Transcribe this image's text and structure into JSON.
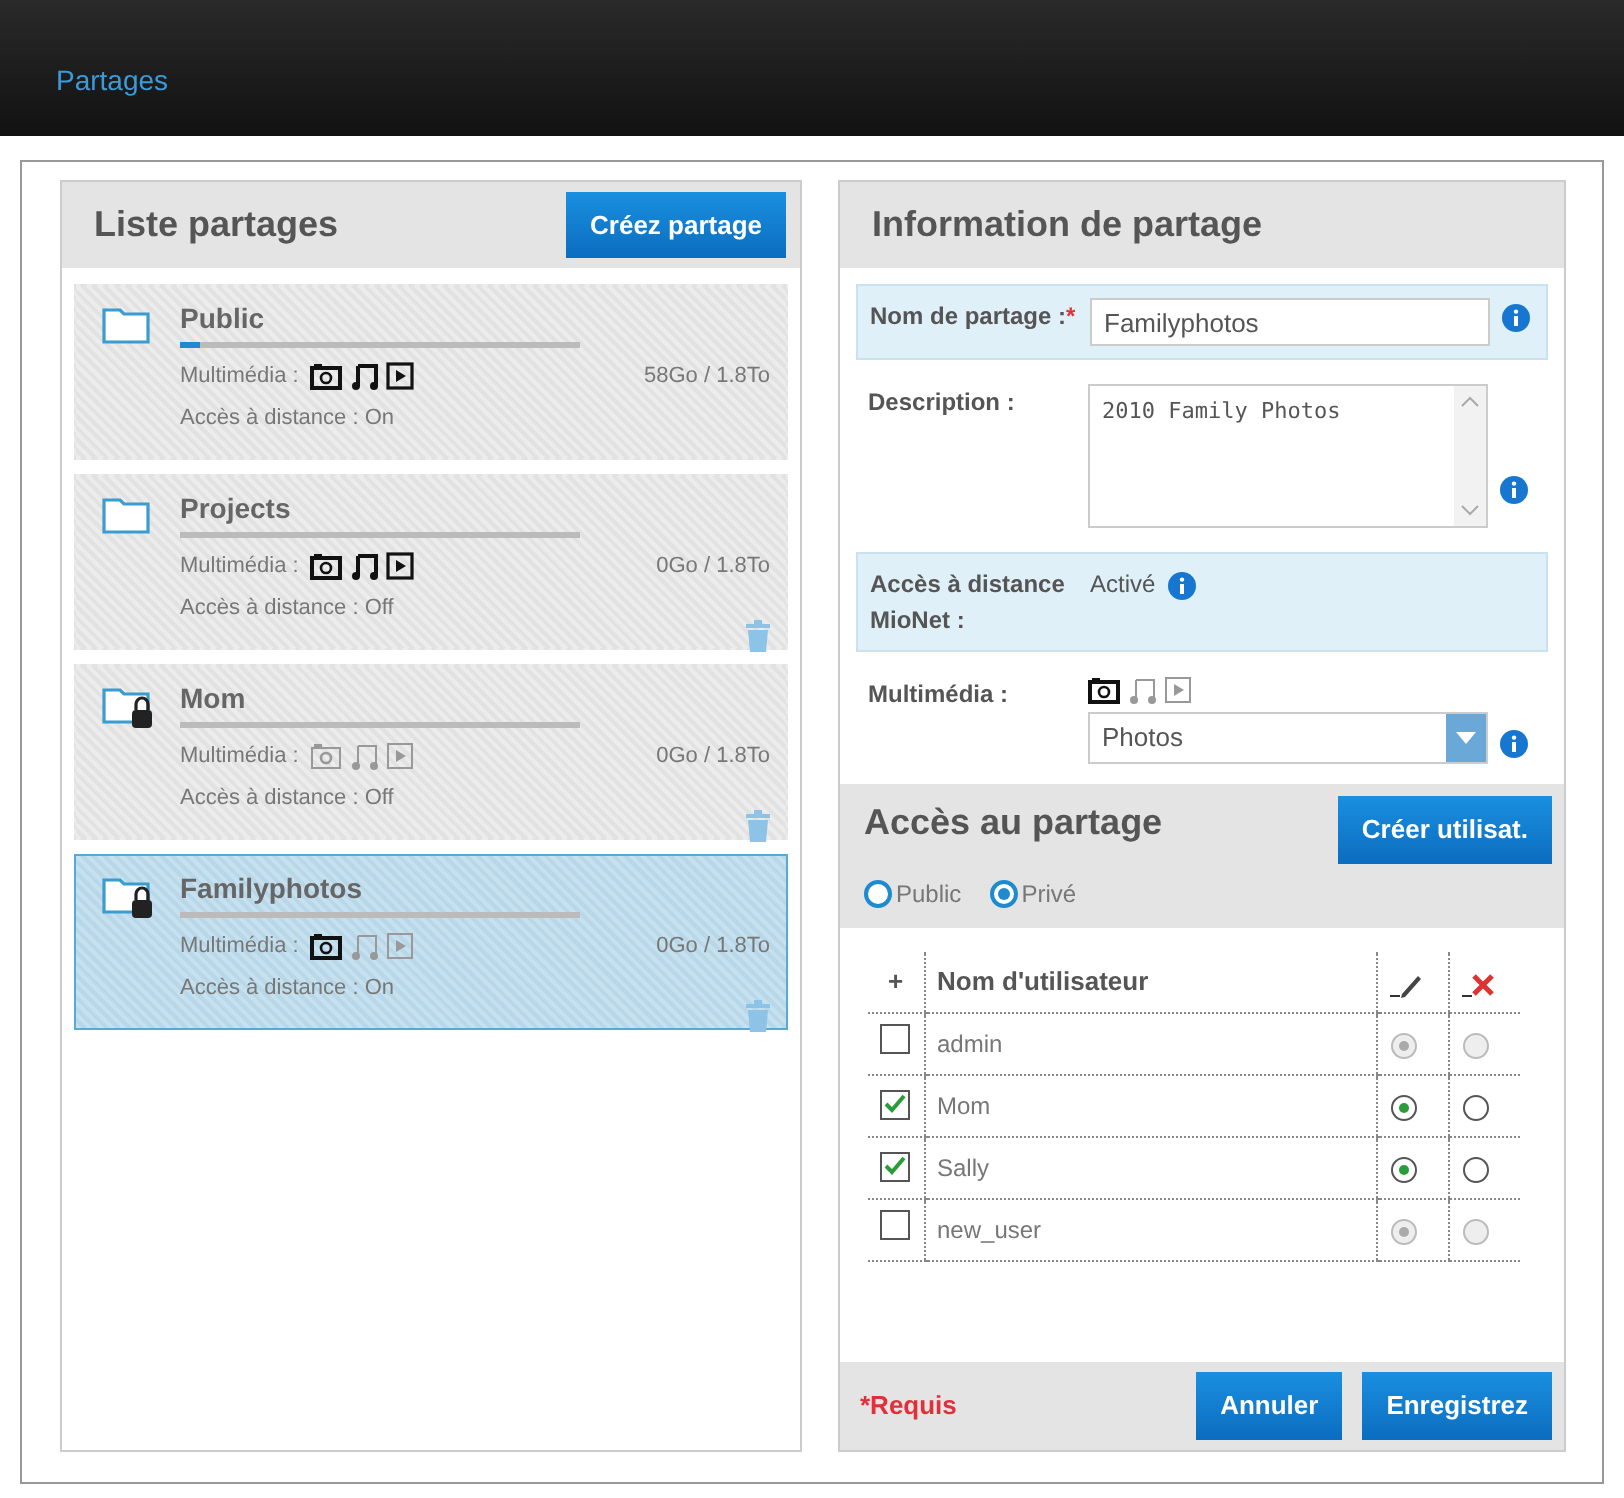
{
  "header": {
    "link": "Partages"
  },
  "share_list": {
    "title": "Liste partages",
    "create_button": "Créez partage",
    "items": [
      {
        "name": "Public",
        "locked": false,
        "level": 0.05,
        "media_label": "Multimédia :",
        "media": {
          "photo": true,
          "music": true,
          "video": true
        },
        "usage": "58Go / 1.8To",
        "remote": "Accès à distance : On",
        "deletable": false,
        "selected": false
      },
      {
        "name": "Projects",
        "locked": false,
        "level": 0,
        "media_label": "Multimédia :",
        "media": {
          "photo": true,
          "music": true,
          "video": true
        },
        "usage": "0Go / 1.8To",
        "remote": "Accès à distance : Off",
        "deletable": true,
        "selected": false
      },
      {
        "name": "Mom",
        "locked": true,
        "level": 0,
        "media_label": "Multimédia :",
        "media": {
          "photo": false,
          "music": false,
          "video": false
        },
        "usage": "0Go / 1.8To",
        "remote": "Accès à distance : Off",
        "deletable": true,
        "selected": false
      },
      {
        "name": "Familyphotos",
        "locked": true,
        "level": 0,
        "media_label": "Multimédia :",
        "media": {
          "photo": true,
          "music": false,
          "video": false
        },
        "usage": "0Go / 1.8To",
        "remote": "Accès à distance : On",
        "deletable": true,
        "selected": true
      }
    ]
  },
  "share_info": {
    "title": "Information de partage",
    "name_label": "Nom de partage :",
    "required_mark": "*",
    "name_value": "Familyphotos",
    "description_label": "Description :",
    "description_value": "2010 Family Photos",
    "remote_label": "Accès à distance MioNet :",
    "remote_value": "Activé",
    "media_label": "Multimédia :",
    "media": {
      "photo": true,
      "music": false,
      "video": false
    },
    "media_select": "Photos"
  },
  "access": {
    "title": "Accès au partage",
    "create_user_button": "Créer utilisat.",
    "modes": [
      {
        "label": "Public",
        "selected": false
      },
      {
        "label": "Privé",
        "selected": true
      }
    ],
    "columns": {
      "add": "+",
      "user": "Nom d'utilisateur"
    },
    "users": [
      {
        "name": "admin",
        "checked": false,
        "disabled": true,
        "read_write": true
      },
      {
        "name": "Mom",
        "checked": true,
        "disabled": false,
        "read_write": true
      },
      {
        "name": "Sally",
        "checked": true,
        "disabled": false,
        "read_write": true
      },
      {
        "name": "new_user",
        "checked": false,
        "disabled": true,
        "read_write": true
      }
    ]
  },
  "footer": {
    "required_note": "*Requis",
    "cancel_button": "Annuler",
    "save_button": "Enregistrez"
  }
}
